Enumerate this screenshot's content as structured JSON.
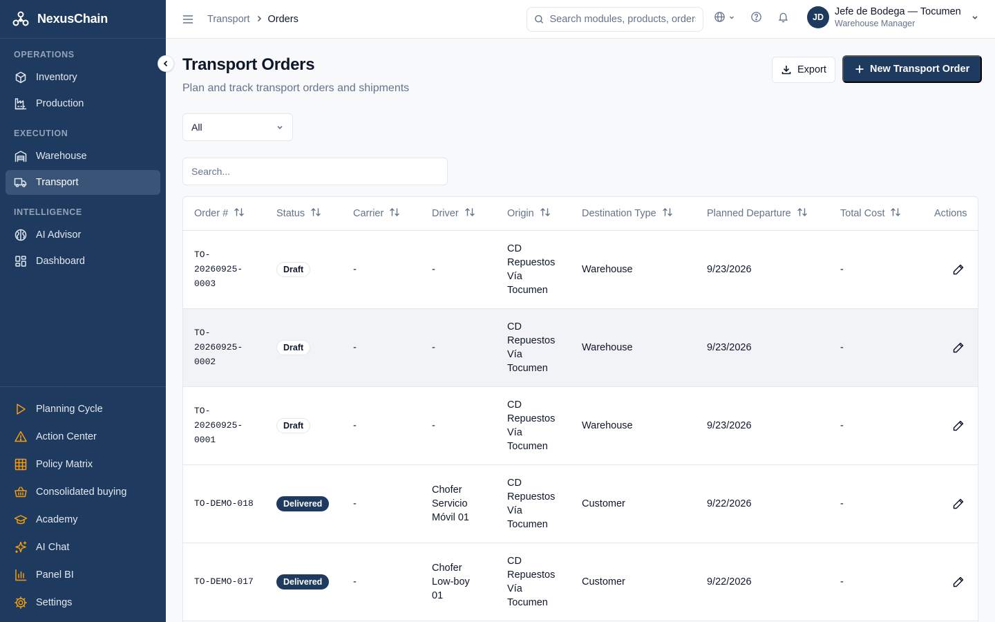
{
  "app": {
    "name": "NexusChain"
  },
  "sidebar": {
    "sections": [
      {
        "label": "OPERATIONS",
        "items": [
          {
            "label": "Inventory",
            "icon": "cube-icon"
          },
          {
            "label": "Production",
            "icon": "factory-icon"
          }
        ]
      },
      {
        "label": "EXECUTION",
        "items": [
          {
            "label": "Warehouse",
            "icon": "warehouse-icon"
          },
          {
            "label": "Transport",
            "icon": "truck-icon",
            "active": true
          }
        ]
      },
      {
        "label": "INTELLIGENCE",
        "items": [
          {
            "label": "AI Advisor",
            "icon": "brain-icon"
          },
          {
            "label": "Dashboard",
            "icon": "dashboard-icon"
          }
        ]
      }
    ],
    "bottom_items": [
      {
        "label": "Planning Cycle",
        "icon": "play-icon"
      },
      {
        "label": "Action Center",
        "icon": "alert-triangle-icon"
      },
      {
        "label": "Policy Matrix",
        "icon": "grid-icon"
      },
      {
        "label": "Consolidated buying",
        "icon": "basket-icon"
      },
      {
        "label": "Academy",
        "icon": "graduation-cap-icon"
      },
      {
        "label": "AI Chat",
        "icon": "sparkles-icon"
      },
      {
        "label": "Panel BI",
        "icon": "bar-chart-icon"
      },
      {
        "label": "Settings",
        "icon": "gear-icon"
      }
    ],
    "accent_color": "#f59e0b"
  },
  "topbar": {
    "breadcrumb": {
      "parent": "Transport",
      "current": "Orders"
    },
    "search_placeholder": "Search modules, products, orders...",
    "user": {
      "initials": "JD",
      "name": "Jefe de Bodega — Tocumen",
      "role": "Warehouse Manager"
    }
  },
  "page": {
    "title": "Transport Orders",
    "subtitle": "Plan and track transport orders and shipments",
    "export_label": "Export",
    "new_label": "New Transport Order",
    "filter_value": "All",
    "search_placeholder": "Search..."
  },
  "table": {
    "columns": [
      {
        "label": "Order #",
        "sortable": true
      },
      {
        "label": "Status",
        "sortable": true
      },
      {
        "label": "Carrier",
        "sortable": true
      },
      {
        "label": "Driver",
        "sortable": true
      },
      {
        "label": "Origin",
        "sortable": true
      },
      {
        "label": "Destination Type",
        "sortable": true
      },
      {
        "label": "Planned Departure",
        "sortable": true
      },
      {
        "label": "Total Cost",
        "sortable": true
      },
      {
        "label": "Actions",
        "sortable": false
      }
    ],
    "rows": [
      {
        "order": "TO-\n20260925-\n0003",
        "status": "Draft",
        "carrier": "-",
        "driver": "-",
        "origin": "CD\nRepuestos\nVía\nTocumen",
        "destination": "Warehouse",
        "departure": "9/23/2026",
        "cost": "-"
      },
      {
        "order": "TO-\n20260925-\n0002",
        "status": "Draft",
        "carrier": "-",
        "driver": "-",
        "origin": "CD\nRepuestos\nVía\nTocumen",
        "destination": "Warehouse",
        "departure": "9/23/2026",
        "cost": "-",
        "hover": true
      },
      {
        "order": "TO-\n20260925-\n0001",
        "status": "Draft",
        "carrier": "-",
        "driver": "-",
        "origin": "CD\nRepuestos\nVía\nTocumen",
        "destination": "Warehouse",
        "departure": "9/23/2026",
        "cost": "-"
      },
      {
        "order": "TO-DEMO-018",
        "status": "Delivered",
        "carrier": "-",
        "driver": "Chofer\nServicio\nMóvil 01",
        "origin": "CD\nRepuestos\nVía\nTocumen",
        "destination": "Customer",
        "departure": "9/22/2026",
        "cost": "-"
      },
      {
        "order": "TO-DEMO-017",
        "status": "Delivered",
        "carrier": "-",
        "driver": "Chofer\nLow-boy\n01",
        "origin": "CD\nRepuestos\nVía\nTocumen",
        "destination": "Customer",
        "departure": "9/22/2026",
        "cost": "-"
      }
    ]
  }
}
